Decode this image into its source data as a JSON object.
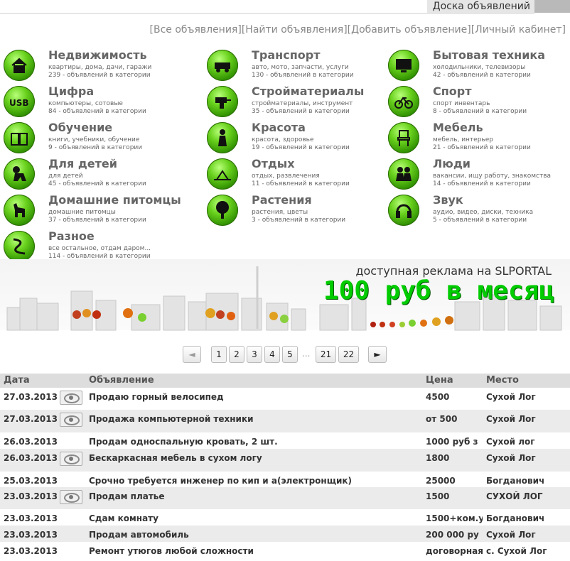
{
  "header": {
    "title": "Доска объявлений"
  },
  "topnav": [
    {
      "label": "[Все объявления]"
    },
    {
      "label": "[Найти объявления]"
    },
    {
      "label": "[Добавить объявление]"
    },
    {
      "label": "[Личный кабинет]"
    }
  ],
  "categories": [
    {
      "name": "Недвижимость",
      "desc": "квартиры, дома, дачи, гаражи",
      "count": "239 - объявлений в категории",
      "icon": "house-icon"
    },
    {
      "name": "Транспорт",
      "desc": "авто, мото, запчасти, услуги",
      "count": "130 - объявлений в категории",
      "icon": "car-icon"
    },
    {
      "name": "Бытовая техника",
      "desc": "холодильники, телевизоры",
      "count": "42 - объявлений в категории",
      "icon": "tv-icon"
    },
    {
      "name": "Цифра",
      "desc": "компьютеры, сотовые",
      "count": "84 - объявлений в категории",
      "icon": "usb-icon"
    },
    {
      "name": "Стройматериалы",
      "desc": "стройматериалы, инструмент",
      "count": "35 - объявлений в категории",
      "icon": "drill-icon"
    },
    {
      "name": "Спорт",
      "desc": "спорт инвентарь",
      "count": "8 - объявлений в категории",
      "icon": "bicycle-icon"
    },
    {
      "name": "Обучение",
      "desc": "книги, учебники, обучение",
      "count": "9 - объявлений в категории",
      "icon": "book-icon"
    },
    {
      "name": "Красота",
      "desc": "красота, здоровье",
      "count": "19 - объявлений в категории",
      "icon": "woman-icon"
    },
    {
      "name": "Мебель",
      "desc": "мебель, интерьер",
      "count": "21 - объявлений в категории",
      "icon": "chair-icon"
    },
    {
      "name": "Для детей",
      "desc": "для детей",
      "count": "45 - объявлений в категории",
      "icon": "baby-icon"
    },
    {
      "name": "Отдых",
      "desc": "отдых, развлечения",
      "count": "11 - объявлений в категории",
      "icon": "beach-icon"
    },
    {
      "name": "Люди",
      "desc": "вакансии, ищу работу, знакомства",
      "count": "14 - объявлений в категории",
      "icon": "people-icon"
    },
    {
      "name": "Домашние питомцы",
      "desc": "домашние питомцы",
      "count": "37 - объявлений в категории",
      "icon": "dog-icon"
    },
    {
      "name": "Растения",
      "desc": "растения, цветы",
      "count": "3 - объявлений в категории",
      "icon": "tree-icon"
    },
    {
      "name": "Звук",
      "desc": "аудио, видео, диски, техника",
      "count": "5 - объявлений в категории",
      "icon": "headphones-icon"
    },
    {
      "name": "Разное",
      "desc": "все остальное, отдам даром...",
      "count": "114 - объявлений в категории",
      "icon": "misc-icon"
    }
  ],
  "banner": {
    "line1": "доступная реклама на SLPORTAL",
    "line2": "100 руб в месяц"
  },
  "pagination": {
    "prev": "◄",
    "pages": [
      "1",
      "2",
      "3",
      "4",
      "5"
    ],
    "ellipsis": "...",
    "last_pages": [
      "21",
      "22"
    ],
    "next": "►",
    "current": "1"
  },
  "table": {
    "headers": {
      "date": "Дата",
      "ad": "Объявление",
      "price": "Цена",
      "place": "Место"
    },
    "rows": [
      {
        "date": "27.03.2013",
        "has_photo": true,
        "ad": "Продаю горный велосипед",
        "price": "4500",
        "place": "Сухой Лог"
      },
      {
        "date": "27.03.2013",
        "has_photo": true,
        "ad": "Продажа компьютерной техники",
        "price": "от 500",
        "place": "Сухой Лог"
      },
      {
        "date": "26.03.2013",
        "has_photo": false,
        "ad": "Продам односпальную кровать, 2 шт.",
        "price": "1000 руб з",
        "place": "Сухой лог"
      },
      {
        "date": "26.03.2013",
        "has_photo": true,
        "ad": "Бескаркасная мебель в сухом логу",
        "price": "1800",
        "place": "Сухой Лог"
      },
      {
        "date": "25.03.2013",
        "has_photo": false,
        "ad": "Срочно требуется инженер по кип и а(электронщик)",
        "price": "25000",
        "place": "Богданович"
      },
      {
        "date": "23.03.2013",
        "has_photo": true,
        "ad": "Продам платье",
        "price": "1500",
        "place": "СУХОЙ ЛОГ"
      },
      {
        "date": "23.03.2013",
        "has_photo": false,
        "ad": "Сдам комнату",
        "price": "1500+ком.у",
        "place": "Богданович"
      },
      {
        "date": "23.03.2013",
        "has_photo": false,
        "ad": "Продам автомобиль",
        "price": "200 000 ру",
        "place": "Сухой Лог"
      },
      {
        "date": "23.03.2013",
        "has_photo": false,
        "ad": "Ремонт утюгов любой сложности",
        "price": "договорная",
        "place": "с. Сухой Лог"
      }
    ]
  },
  "colors": {
    "accent": "#00cc00",
    "row_alt": "#ebebeb",
    "header_bg": "#dddddd"
  }
}
